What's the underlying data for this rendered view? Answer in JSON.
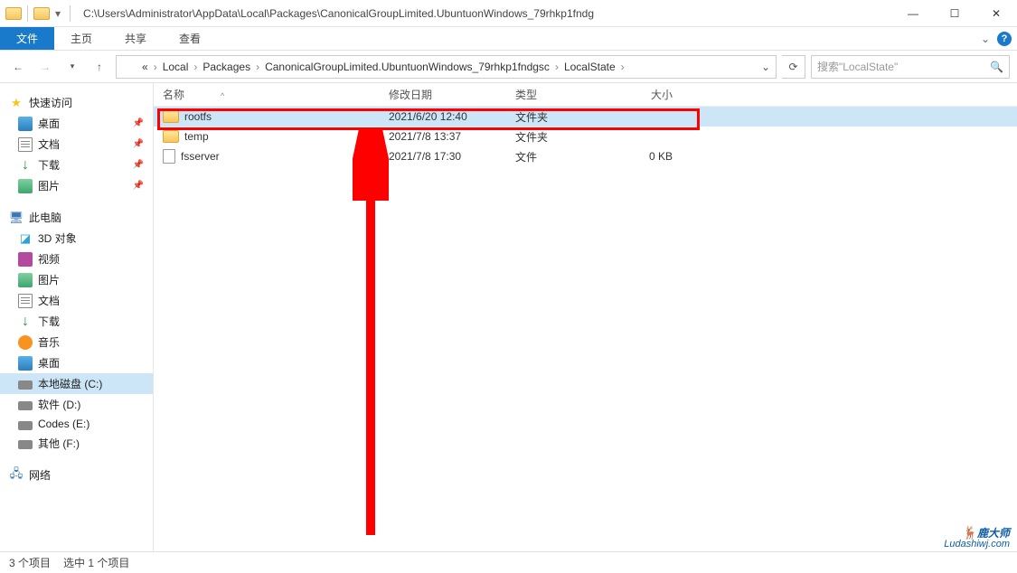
{
  "title_path": "C:\\Users\\Administrator\\AppData\\Local\\Packages\\CanonicalGroupLimited.UbuntuonWindows_79rhkp1fndg",
  "ribbon": {
    "file": "文件",
    "home": "主页",
    "share": "共享",
    "view": "查看"
  },
  "breadcrumb": {
    "prefix": "«",
    "parts": [
      "Local",
      "Packages",
      "CanonicalGroupLimited.UbuntuonWindows_79rhkp1fndgsc",
      "LocalState"
    ]
  },
  "search": {
    "placeholder": "搜索\"LocalState\""
  },
  "columns": {
    "name": "名称",
    "date": "修改日期",
    "type": "类型",
    "size": "大小"
  },
  "rows": [
    {
      "icon": "folder",
      "name": "rootfs",
      "date": "2021/6/20 12:40",
      "type": "文件夹",
      "size": "",
      "selected": true
    },
    {
      "icon": "folder",
      "name": "temp",
      "date": "2021/7/8 13:37",
      "type": "文件夹",
      "size": "",
      "selected": false
    },
    {
      "icon": "file",
      "name": "fsserver",
      "date": "2021/7/8 17:30",
      "type": "文件",
      "size": "0 KB",
      "selected": false
    }
  ],
  "sidebar": {
    "quick": {
      "label": "快速访问",
      "items": [
        {
          "label": "桌面",
          "icon": "desk",
          "pin": true
        },
        {
          "label": "文档",
          "icon": "doc",
          "pin": true
        },
        {
          "label": "下载",
          "icon": "down",
          "pin": true
        },
        {
          "label": "图片",
          "icon": "pic",
          "pin": true
        }
      ]
    },
    "pc": {
      "label": "此电脑",
      "items": [
        {
          "label": "3D 对象",
          "icon": "3d"
        },
        {
          "label": "视频",
          "icon": "vid"
        },
        {
          "label": "图片",
          "icon": "pic"
        },
        {
          "label": "文档",
          "icon": "doc"
        },
        {
          "label": "下载",
          "icon": "down"
        },
        {
          "label": "音乐",
          "icon": "music"
        },
        {
          "label": "桌面",
          "icon": "desk"
        },
        {
          "label": "本地磁盘 (C:)",
          "icon": "disk",
          "selected": true
        },
        {
          "label": "软件 (D:)",
          "icon": "disk"
        },
        {
          "label": "Codes (E:)",
          "icon": "disk"
        },
        {
          "label": "其他 (F:)",
          "icon": "disk"
        }
      ]
    },
    "net": {
      "label": "网络"
    }
  },
  "status": {
    "count": "3 个项目",
    "selected": "选中 1 个项目"
  },
  "watermark": {
    "main": "鹿大师",
    "sub": "Ludashiwj.com"
  }
}
